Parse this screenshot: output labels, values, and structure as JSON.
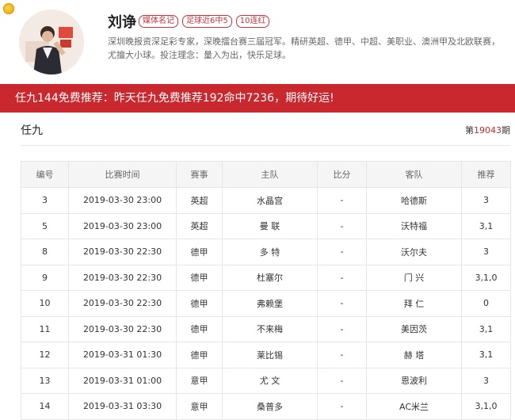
{
  "profile": {
    "name": "刘诤",
    "badges": [
      "媒体名记",
      "足球近6中5",
      "10连红"
    ],
    "bio": "深圳晚报资深足彩专家，深晚擂台赛三届冠军。精研英超、德甲、中超、美职业、澳洲甲及北欧联赛，尤擅大小球。投注理念：量入为出，快乐足球。"
  },
  "banner": {
    "text": "任九144免费推荐：昨天任九免费推荐192命中7236，期待好运!"
  },
  "section": {
    "title": "任九",
    "issue_prefix": "第",
    "issue_number": "19043",
    "issue_suffix": "期"
  },
  "table": {
    "headers": [
      "编号",
      "比赛时间",
      "赛事",
      "主队",
      "比分",
      "客队",
      "推荐"
    ],
    "rows": [
      [
        "3",
        "2019-03-30 23:00",
        "英超",
        "水晶宫",
        "-",
        "哈德斯",
        "3"
      ],
      [
        "5",
        "2019-03-30 23:00",
        "英超",
        "曼 联",
        "-",
        "沃特福",
        "3,1"
      ],
      [
        "8",
        "2019-03-30 22:30",
        "德甲",
        "多 特",
        "-",
        "沃尔夫",
        "3"
      ],
      [
        "9",
        "2019-03-30 22:30",
        "德甲",
        "杜塞尔",
        "-",
        "门 兴",
        "3,1,0"
      ],
      [
        "10",
        "2019-03-30 22:30",
        "德甲",
        "弗赖堡",
        "-",
        "拜 仁",
        "0"
      ],
      [
        "11",
        "2019-03-30 22:30",
        "德甲",
        "不来梅",
        "-",
        "美因茨",
        "3,1"
      ],
      [
        "12",
        "2019-03-31 01:30",
        "德甲",
        "莱比锡",
        "-",
        "赫 塔",
        "3,1"
      ],
      [
        "13",
        "2019-03-31 01:00",
        "意甲",
        "尤 文",
        "-",
        "恩波利",
        "3"
      ],
      [
        "14",
        "2019-03-31 03:30",
        "意甲",
        "桑普多",
        "-",
        "AC米兰",
        "3,1,0"
      ]
    ]
  },
  "colors": {
    "accent": "#c8282e",
    "badge_border": "#d0323c"
  }
}
